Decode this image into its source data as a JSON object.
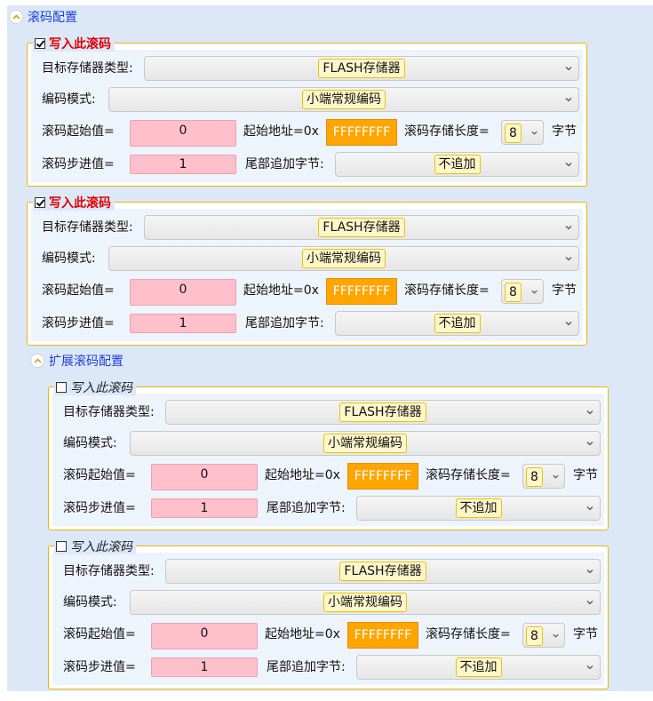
{
  "main_header": "滚码配置",
  "ext_header": "扩展滚码配置",
  "labels": {
    "target": "目标存储器类型:",
    "encode": "编码模式:",
    "start": "滚码起始值=",
    "addr": "起始地址=0x",
    "len": "滚码存储长度=",
    "bytes": "字节",
    "step": "滚码步进值=",
    "tail": "尾部追加字节:"
  },
  "groups": [
    {
      "checked": true,
      "title": "写入此滚码",
      "target": "FLASH存储器",
      "encode": "小端常规编码",
      "start": "0",
      "addr": "FFFFFFFF",
      "len": "8",
      "step": "1",
      "tail": "不追加"
    },
    {
      "checked": true,
      "title": "写入此滚码",
      "target": "FLASH存储器",
      "encode": "小端常规编码",
      "start": "0",
      "addr": "FFFFFFFF",
      "len": "8",
      "step": "1",
      "tail": "不追加"
    },
    {
      "checked": false,
      "title": "写入此滚码",
      "target": "FLASH存储器",
      "encode": "小端常规编码",
      "start": "0",
      "addr": "FFFFFFFF",
      "len": "8",
      "step": "1",
      "tail": "不追加"
    },
    {
      "checked": false,
      "title": "写入此滚码",
      "target": "FLASH存储器",
      "encode": "小端常规编码",
      "start": "0",
      "addr": "FFFFFFFF",
      "len": "8",
      "step": "1",
      "tail": "不追加"
    }
  ]
}
